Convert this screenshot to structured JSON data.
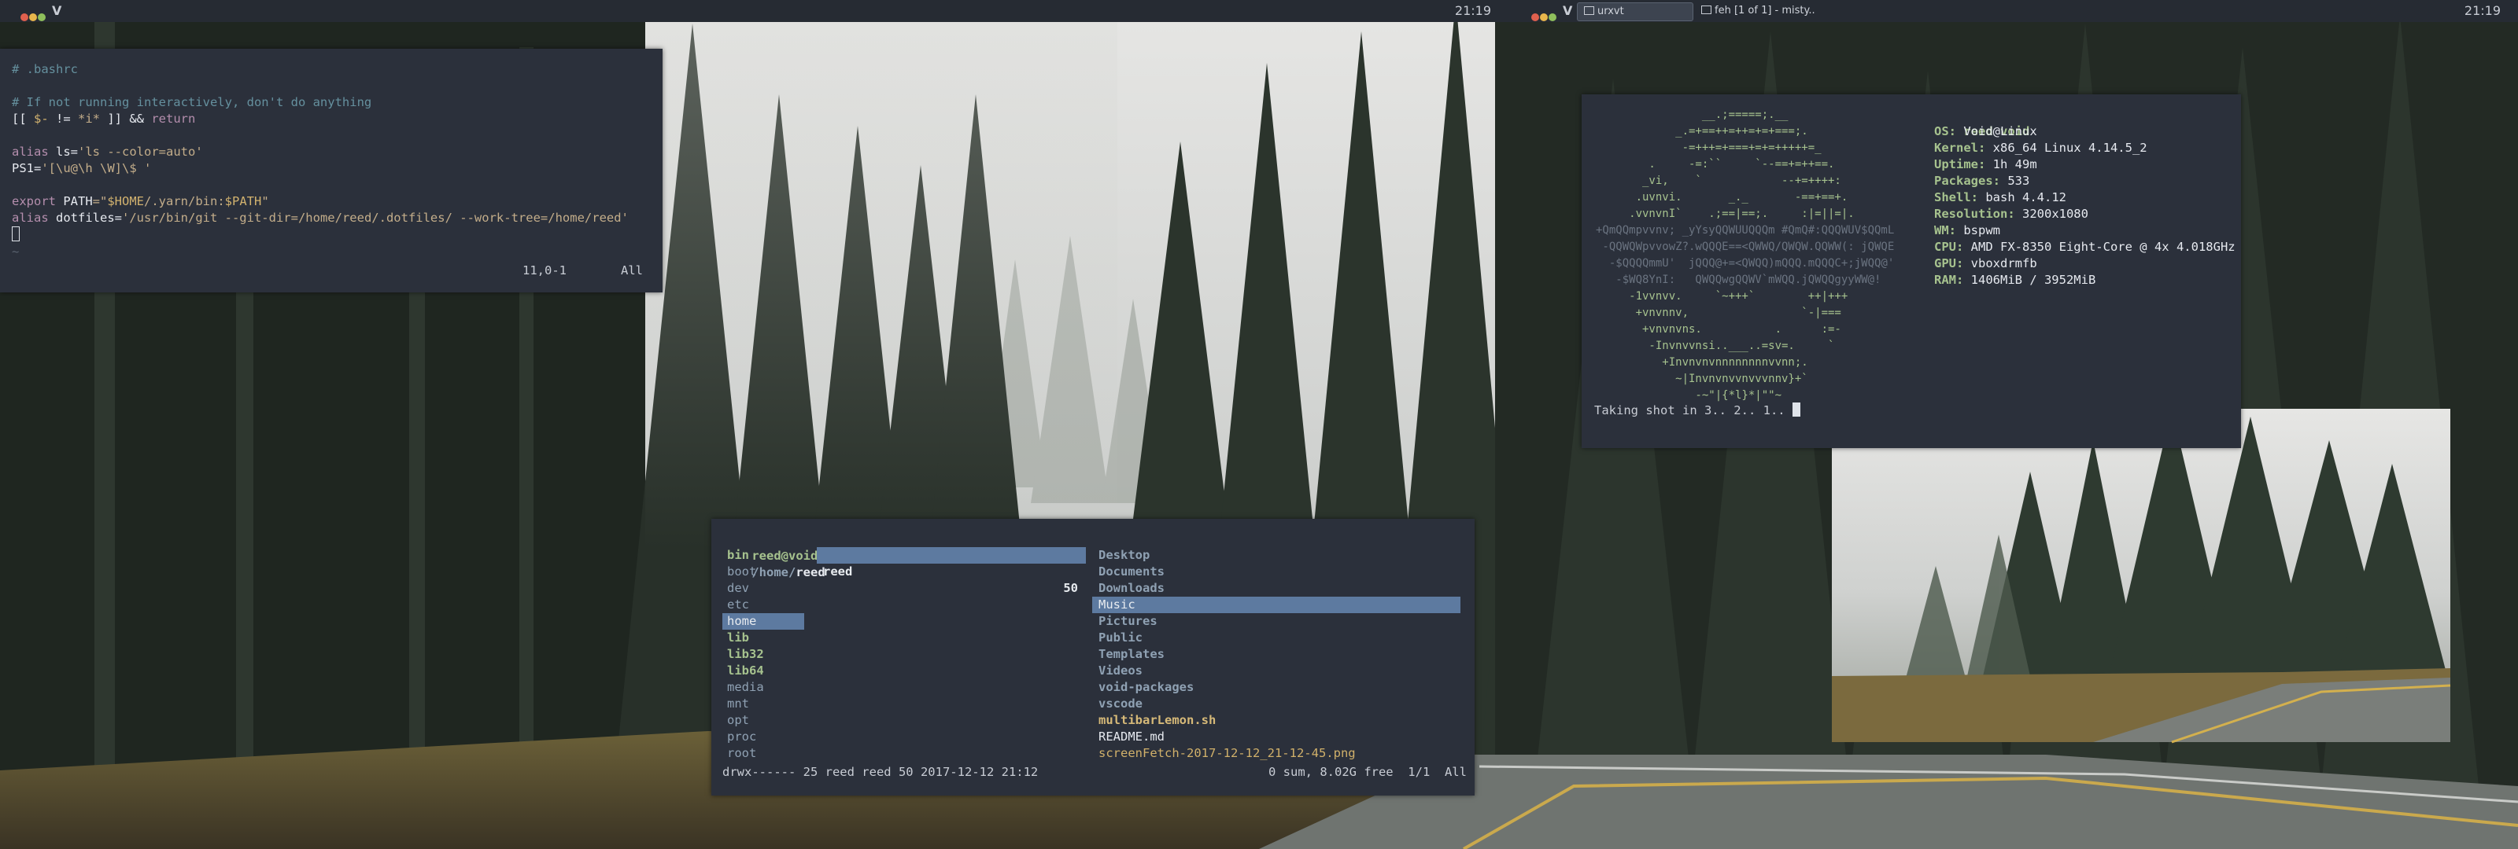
{
  "colors": {
    "bar_bg": "#262b33",
    "terminal_bg": "#2b303b",
    "selection": "#5d7aa0",
    "accent_green": "#a6c28e"
  },
  "bar_left": {
    "workspace": "V",
    "clock": "21:19"
  },
  "bar_right": {
    "workspace": "V",
    "clock": "21:19",
    "tasks": [
      {
        "icon": "terminal-icon",
        "label": "urxvt"
      },
      {
        "icon": "image-icon",
        "label": "feh [1 of 1] - misty..."
      }
    ]
  },
  "vim": {
    "lines": [
      [
        {
          "t": "# .bashrc",
          "c": "c-com"
        }
      ],
      [],
      [
        {
          "t": "# If not running interactively, don't do anything",
          "c": "c-com"
        }
      ],
      [
        {
          "t": "[[ ",
          "c": "c-wh"
        },
        {
          "t": "$-",
          "c": "c-var"
        },
        {
          "t": " != ",
          "c": "c-wh"
        },
        {
          "t": "*i*",
          "c": "c-str"
        },
        {
          "t": " ]] && ",
          "c": "c-wh"
        },
        {
          "t": "return",
          "c": "c-kw"
        }
      ],
      [],
      [
        {
          "t": "alias ",
          "c": "c-kw"
        },
        {
          "t": "ls",
          "c": "c-wh"
        },
        {
          "t": "=",
          "c": "c-wh"
        },
        {
          "t": "'ls --color=auto'",
          "c": "c-str"
        }
      ],
      [
        {
          "t": "PS1",
          "c": "c-wh"
        },
        {
          "t": "=",
          "c": "c-wh"
        },
        {
          "t": "'[\\u@\\h \\W]\\$ '",
          "c": "c-str"
        }
      ],
      [],
      [
        {
          "t": "export ",
          "c": "c-kw"
        },
        {
          "t": "PATH",
          "c": "c-wh"
        },
        {
          "t": "=\"",
          "c": "c-str"
        },
        {
          "t": "$HOME",
          "c": "c-var"
        },
        {
          "t": "/.yarn/bin:",
          "c": "c-str"
        },
        {
          "t": "$PATH",
          "c": "c-var"
        },
        {
          "t": "\"",
          "c": "c-str"
        }
      ],
      [
        {
          "t": "alias ",
          "c": "c-kw"
        },
        {
          "t": "dotfiles",
          "c": "c-wh"
        },
        {
          "t": "=",
          "c": "c-wh"
        },
        {
          "t": "'/usr/bin/git --git-dir=/home/reed/.dotfiles/ --work-tree=/home/reed'",
          "c": "c-str"
        }
      ]
    ],
    "tilde": "~",
    "status_pos": "11,0-1",
    "status_pct": "All"
  },
  "neofetch": {
    "logo": [
      "                __.;=====;.__",
      "            _.=+==++=++=+=+===;.",
      "             -=+++=+===+=+=+++++=_",
      "        .     -=:``     `--==+=++==.",
      "       _vi,    `            --+=++++:",
      "      .uvnvi.       _._       -==+==+.",
      "     .vvnvnI`    .;==|==;.     :|=||=|.",
      "+QmQQmpvvnv; _yYsyQQWUUQQQm #QmQ#:QQQWUV$QQmL",
      " -QQWQWpvvowZ?.wQQQE==<QWWQ/QWQW.QQWW(: jQWQE",
      "  -$QQQQmmU'  jQQQ@+=<QWQQ)mQQQ.mQQQC+;jWQQ@'",
      "   -$WQ8YnI:   QWQQwgQQWV`mWQQ.jQWQQgyyWW@!",
      "     -1vvnvv.     `~+++`        ++|+++",
      "      +vnvnnv,                 `-|===",
      "       +vnvnvns.           .      :=-",
      "        -Invnvvnsi..___..=sv=.     `",
      "          +Invnvnvnnnnnnnnvvnn;.",
      "            ~|Invnvnvvnvvvnnv}+`",
      "               -~\"|{*l}*|\"\"~"
    ],
    "user": "reed",
    "host": "void",
    "info": [
      {
        "k": "OS",
        "v": "Void Linux"
      },
      {
        "k": "Kernel",
        "v": "x86_64 Linux 4.14.5_2"
      },
      {
        "k": "Uptime",
        "v": "1h 49m"
      },
      {
        "k": "Packages",
        "v": "533"
      },
      {
        "k": "Shell",
        "v": "bash 4.4.12"
      },
      {
        "k": "Resolution",
        "v": "3200x1080"
      },
      {
        "k": "WM",
        "v": "bspwm"
      },
      {
        "k": "CPU",
        "v": "AMD FX-8350 Eight-Core @ 4x 4.018GHz"
      },
      {
        "k": "GPU",
        "v": "vboxdrmfb"
      },
      {
        "k": "RAM",
        "v": "1406MiB / 3952MiB"
      }
    ],
    "shot": "Taking shot in 3.. 2.. 1.. "
  },
  "ranger": {
    "user_host": "reed@void",
    "path_dir": "/home/",
    "path_leaf": "reed",
    "col1": [
      {
        "n": "bin",
        "b": true
      },
      {
        "n": "boot",
        "b": false
      },
      {
        "n": "dev",
        "b": false
      },
      {
        "n": "etc",
        "b": false
      },
      {
        "n": "home",
        "b": false,
        "sel": true
      },
      {
        "n": "lib",
        "b": true
      },
      {
        "n": "lib32",
        "b": true
      },
      {
        "n": "lib64",
        "b": true
      },
      {
        "n": "media",
        "b": false
      },
      {
        "n": "mnt",
        "b": false
      },
      {
        "n": "opt",
        "b": false
      },
      {
        "n": "proc",
        "b": false
      },
      {
        "n": "root",
        "b": false
      }
    ],
    "col2": {
      "name": "reed",
      "count": "50"
    },
    "col3": [
      {
        "n": "Desktop",
        "c": "c-blb"
      },
      {
        "n": "Documents",
        "c": "c-blb"
      },
      {
        "n": "Downloads",
        "c": "c-blb"
      },
      {
        "n": "Music",
        "c": "c-blb",
        "sel": true
      },
      {
        "n": "Pictures",
        "c": "c-blb"
      },
      {
        "n": "Public",
        "c": "c-blb"
      },
      {
        "n": "Templates",
        "c": "c-blb"
      },
      {
        "n": "Videos",
        "c": "c-blb"
      },
      {
        "n": "void-packages",
        "c": "c-blb"
      },
      {
        "n": "vscode",
        "c": "c-blb"
      },
      {
        "n": "multibarLemon.sh",
        "c": "c-yl"
      },
      {
        "n": "README.md",
        "c": "c-wh"
      },
      {
        "n": "screenFetch-2017-12-12_21-12-45.png",
        "c": "c-yr"
      }
    ],
    "status_left": "drwx------ 25 reed reed 50 2017-12-12 21:12",
    "status_right": "0 sum, 8.02G free  1/1  All"
  }
}
